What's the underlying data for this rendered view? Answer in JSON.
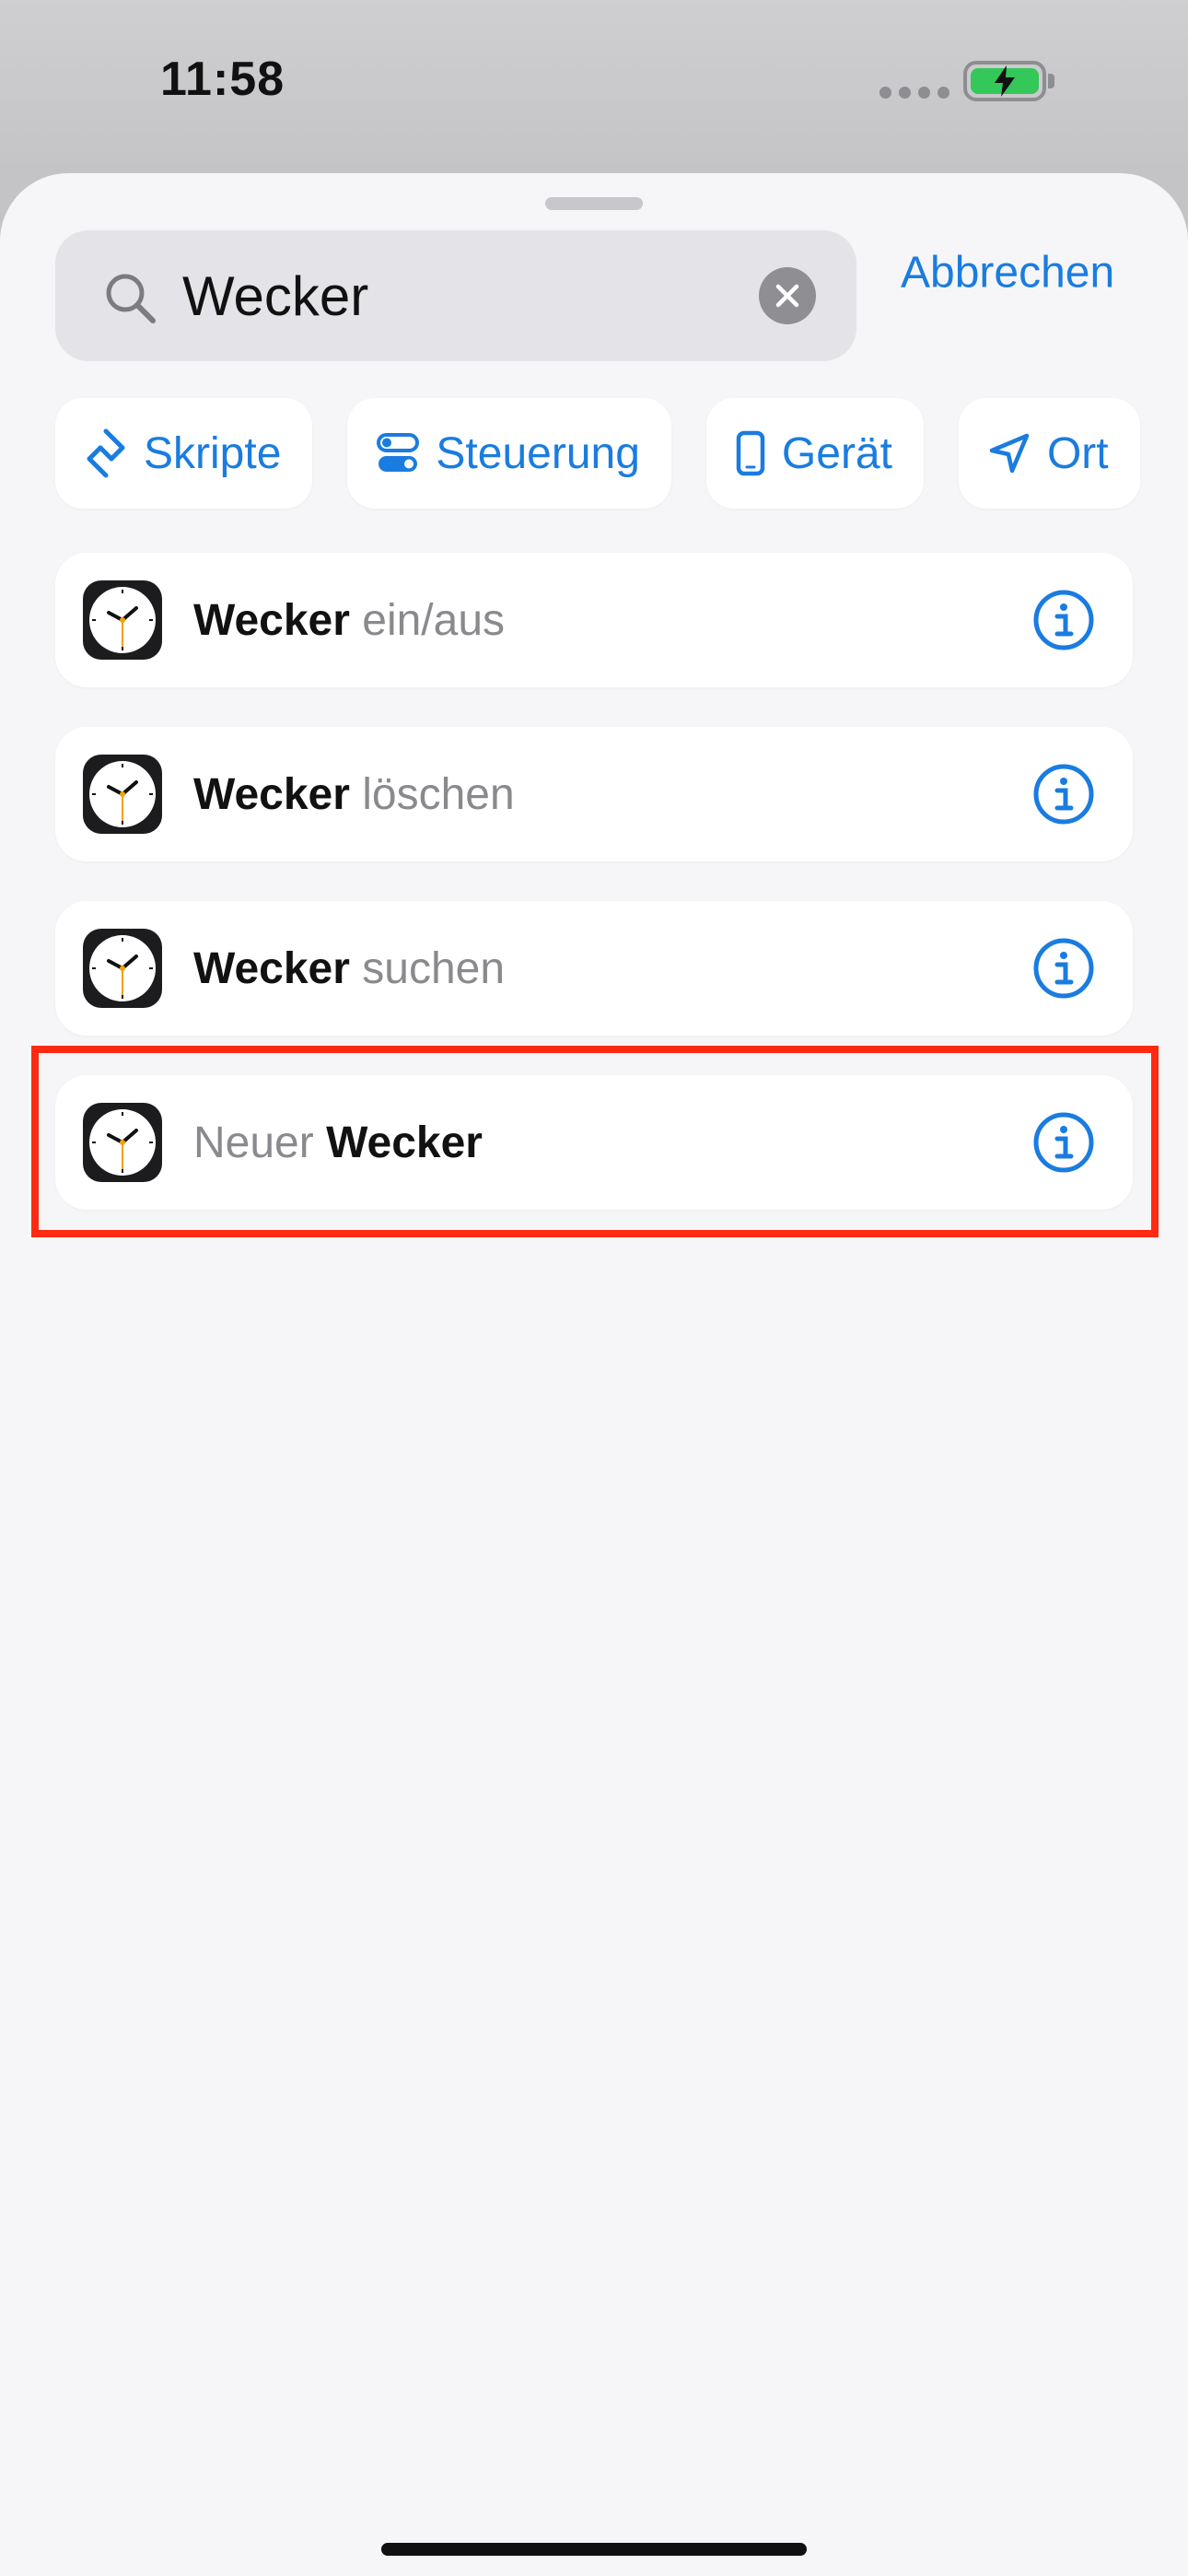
{
  "status_bar": {
    "time": "11:58"
  },
  "search": {
    "value": "Wecker"
  },
  "cancel_label": "Abbrechen",
  "chips": [
    {
      "label": "Skripte",
      "icon": "shortcuts-icon"
    },
    {
      "label": "Steuerung",
      "icon": "toggle-icon"
    },
    {
      "label": "Gerät",
      "icon": "phone-icon"
    },
    {
      "label": "Ort",
      "icon": "location-arrow-icon"
    }
  ],
  "results": [
    {
      "bold": "Wecker",
      "dim": "ein/aus",
      "order": "bold-first"
    },
    {
      "bold": "Wecker",
      "dim": "löschen",
      "order": "bold-first"
    },
    {
      "bold": "Wecker",
      "dim": "suchen",
      "order": "bold-first"
    },
    {
      "bold": "Wecker",
      "dim": "Neuer",
      "order": "dim-first"
    }
  ],
  "colors": {
    "accent": "#1a7ce0",
    "highlight": "#ff2a12",
    "battery": "#34c759"
  }
}
